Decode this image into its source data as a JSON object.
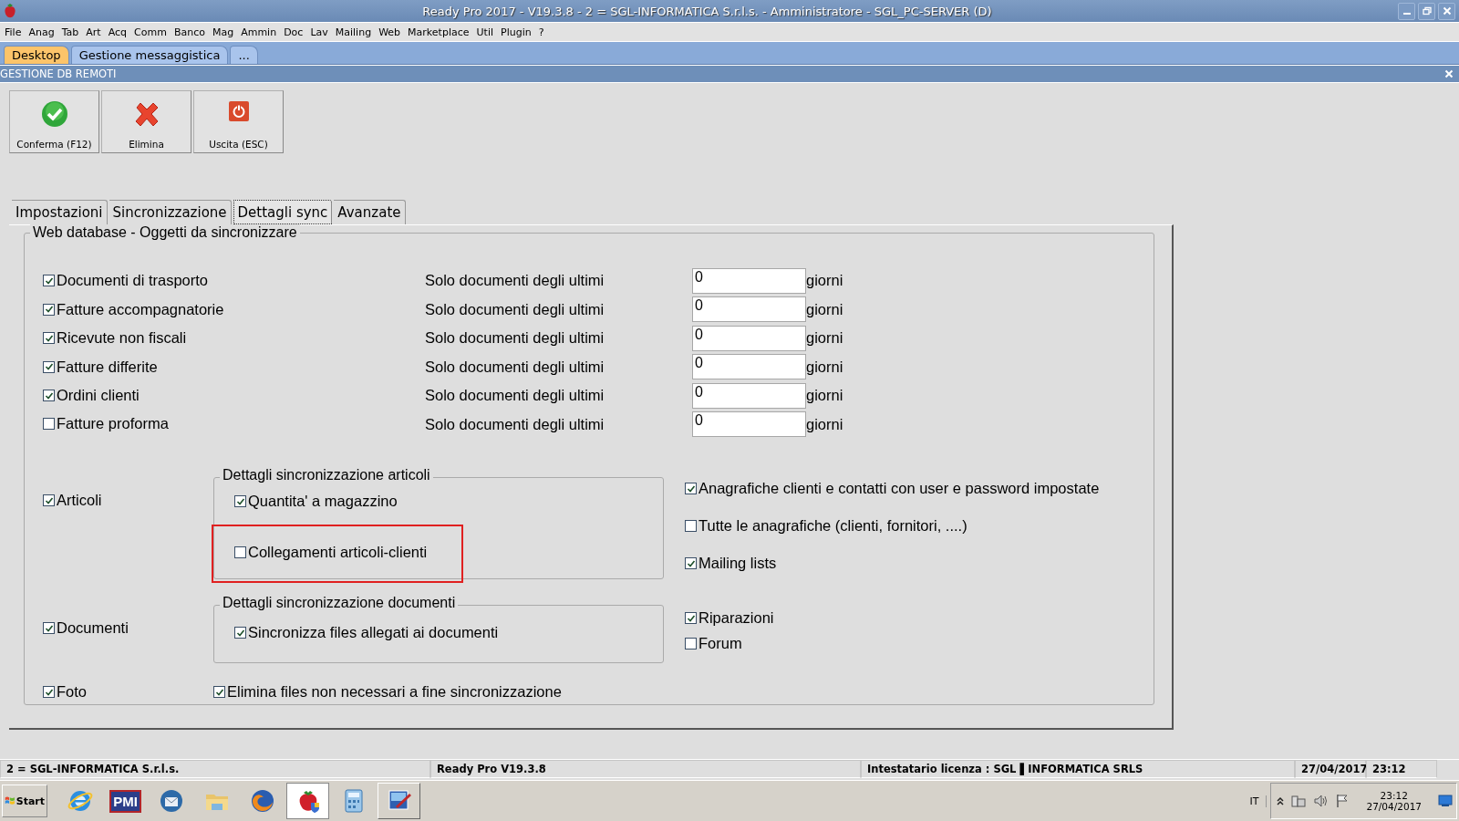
{
  "window": {
    "title": "Ready Pro 2017 - V19.3.8 - 2 = SGL-INFORMATICA S.r.l.s. - Amministratore - SGL_PC-SERVER (D)"
  },
  "menu": [
    "File",
    "Anag",
    "Tab",
    "Art",
    "Acq",
    "Comm",
    "Banco",
    "Mag",
    "Ammin",
    "Doc",
    "Lav",
    "Mailing",
    "Web",
    "Marketplace",
    "Util",
    "Plugin",
    "?"
  ],
  "app_tabs": [
    {
      "label": "Desktop",
      "selected": true
    },
    {
      "label": "Gestione messaggistica",
      "selected": false
    },
    {
      "label": "...",
      "selected": false
    }
  ],
  "section_title": "GESTIONE DB REMOTI",
  "toolbar": [
    {
      "kind": "confirm",
      "label": "Conferma (F12)"
    },
    {
      "kind": "delete",
      "label": "Elimina"
    },
    {
      "kind": "exit",
      "label": "Uscita (ESC)"
    }
  ],
  "tabs": [
    {
      "label": "Impostazioni",
      "selected": false
    },
    {
      "label": "Sincronizzazione",
      "selected": false
    },
    {
      "label": "Dettagli sync",
      "selected": true
    },
    {
      "label": "Avanzate",
      "selected": false
    }
  ],
  "group_title": "Web database - Oggetti da sincronizzare",
  "document_rows": [
    {
      "label": "Documenti di trasporto",
      "checked": true,
      "prefix": "Solo documenti degli ultimi",
      "value": "0",
      "suffix": "giorni"
    },
    {
      "label": "Fatture accompagnatorie",
      "checked": true,
      "prefix": "Solo documenti degli ultimi",
      "value": "0",
      "suffix": "giorni"
    },
    {
      "label": "Ricevute non fiscali",
      "checked": true,
      "prefix": "Solo documenti degli ultimi",
      "value": "0",
      "suffix": "giorni"
    },
    {
      "label": "Fatture differite",
      "checked": true,
      "prefix": "Solo documenti degli ultimi",
      "value": "0",
      "suffix": "giorni"
    },
    {
      "label": "Ordini clienti",
      "checked": true,
      "prefix": "Solo documenti degli ultimi",
      "value": "0",
      "suffix": "giorni"
    },
    {
      "label": "Fatture proforma",
      "checked": false,
      "prefix": "Solo documenti degli ultimi",
      "value": "0",
      "suffix": "giorni"
    }
  ],
  "articoli": {
    "label": "Articoli",
    "checked": true
  },
  "articoli_details": {
    "title": "Dettagli sincronizzazione articoli",
    "options": [
      {
        "label": "Quantita' a magazzino",
        "checked": true,
        "highlighted": false
      },
      {
        "label": "Collegamenti articoli-clienti",
        "checked": false,
        "highlighted": true
      }
    ]
  },
  "right_options_1": [
    {
      "label": "Anagrafiche clienti e contatti con user e password impostate",
      "checked": true
    },
    {
      "label": "Tutte le anagrafiche (clienti, fornitori, ....)",
      "checked": false
    },
    {
      "label": "Mailing lists",
      "checked": true
    }
  ],
  "documenti": {
    "label": "Documenti",
    "checked": true
  },
  "documenti_details": {
    "title": "Dettagli sincronizzazione documenti",
    "options": [
      {
        "label": "Sincronizza files allegati ai documenti",
        "checked": true,
        "highlighted": false
      }
    ]
  },
  "right_options_2": [
    {
      "label": "Riparazioni",
      "checked": true
    },
    {
      "label": "Forum",
      "checked": false
    }
  ],
  "foto": {
    "label": "Foto",
    "checked": true
  },
  "cleanup": {
    "label": "Elimina files non necessari a fine sincronizzazione",
    "checked": true
  },
  "status_bar": [
    "2 = SGL-INFORMATICA S.r.l.s.",
    "Ready Pro V19.3.8",
    "Intestatario licenza : SGL ▌INFORMATICA SRLS",
    "27/04/2017",
    "23:12"
  ],
  "taskbar": {
    "start": "Start",
    "apps": [
      {
        "kind": "browser-e",
        "selected": false
      },
      {
        "kind": "pmi",
        "label": "PMI",
        "selected": false
      },
      {
        "kind": "mail",
        "selected": false
      },
      {
        "kind": "folder",
        "selected": false
      },
      {
        "kind": "firefox",
        "selected": false
      },
      {
        "kind": "strawberry",
        "selected": true
      },
      {
        "kind": "calculator",
        "selected": false
      },
      {
        "kind": "paint",
        "selected": false
      }
    ],
    "language": "IT",
    "time": "23:12",
    "date": "27/04/2017"
  }
}
